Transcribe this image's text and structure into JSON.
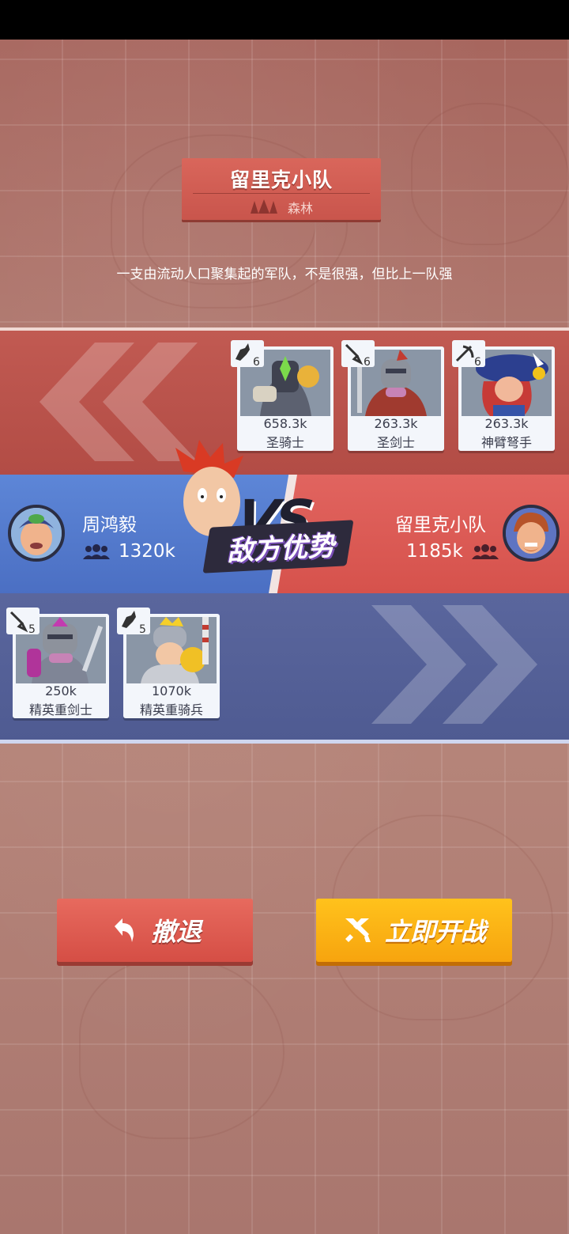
{
  "title_banner": {
    "title": "留里克小队",
    "terrain_icon": "forest-icon",
    "terrain": "森林"
  },
  "description": "一支由流动人口聚集起的军队，不是很强，但比上一队强",
  "enemy": {
    "name": "留里克小队",
    "power": "1185k",
    "units": [
      {
        "level": "6",
        "class_icon": "cavalry-icon",
        "power": "658.3k",
        "name": "圣骑士"
      },
      {
        "level": "6",
        "class_icon": "sword-icon",
        "power": "263.3k",
        "name": "圣剑士"
      },
      {
        "level": "6",
        "class_icon": "crossbow-icon",
        "power": "263.3k",
        "name": "神臂弩手"
      }
    ]
  },
  "player": {
    "name": "周鸿毅",
    "power": "1320k",
    "units": [
      {
        "level": "5",
        "class_icon": "sword-icon",
        "power": "250k",
        "name": "精英重剑士"
      },
      {
        "level": "5",
        "class_icon": "cavalry-icon",
        "power": "1070k",
        "name": "精英重骑兵"
      }
    ]
  },
  "versus": {
    "status": "敌方优势"
  },
  "buttons": {
    "retreat_label": "撤退",
    "retreat_icon": "return-arrow-icon",
    "start_label": "立即开战",
    "start_icon": "crossed-swords-icon"
  },
  "colors": {
    "enemy_red": "#c15a52",
    "player_blue": "#4f5b92",
    "retreat_button": "#d54e45",
    "start_button": "#f7a40e"
  }
}
